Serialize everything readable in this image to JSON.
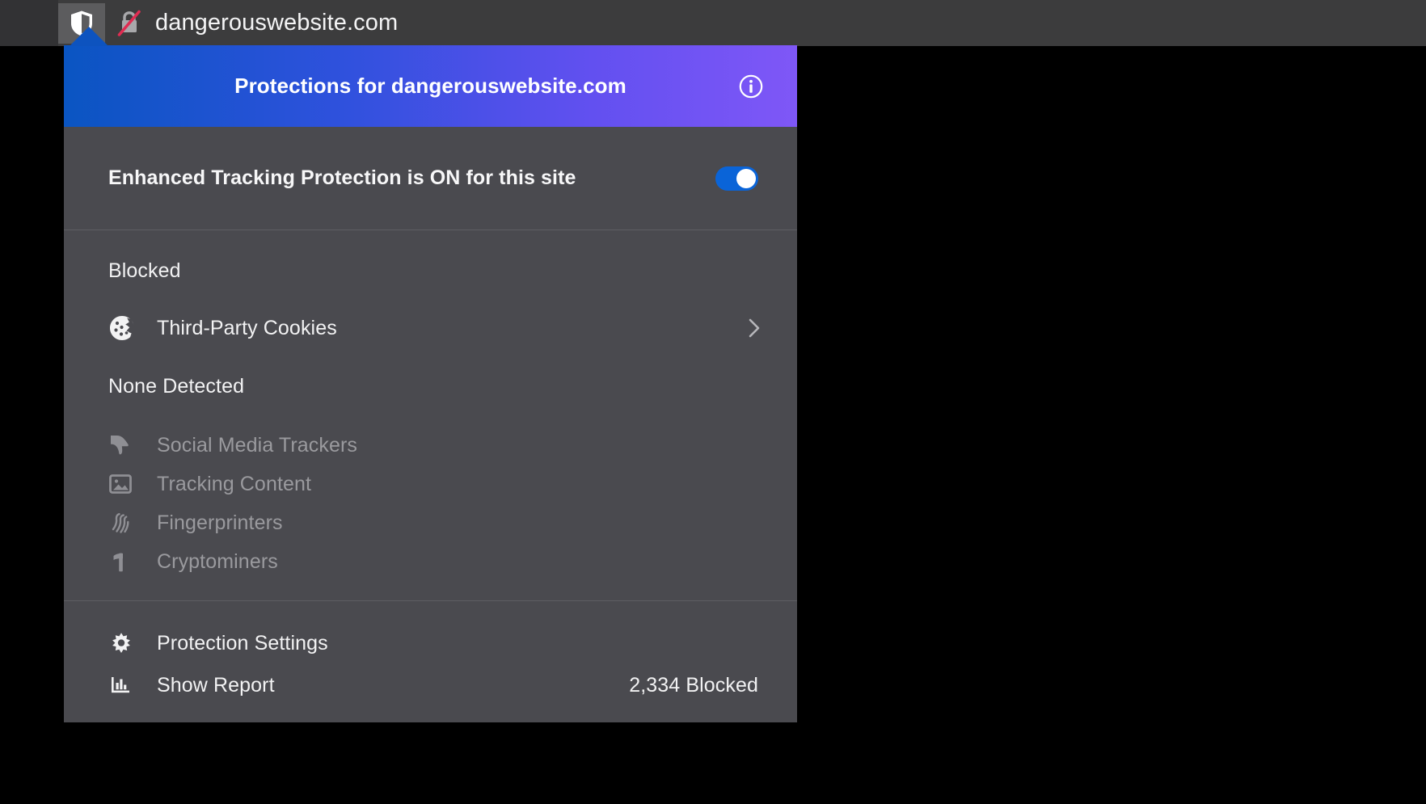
{
  "urlbar": {
    "url": "dangerouswebsite.com",
    "shield_icon": "shield-icon",
    "connection_icon": "lock-slashed-insecure-icon"
  },
  "panel": {
    "header": {
      "title": "Protections for dangerouswebsite.com",
      "info_icon": "info-circle-icon",
      "gradient_start": "#0a55c2",
      "gradient_end": "#7f57f7"
    },
    "etp": {
      "label": "Enhanced Tracking Protection is ON for this site",
      "toggle_state": "on",
      "toggle_color": "#0a64d8"
    },
    "blocked": {
      "heading": "Blocked",
      "items": [
        {
          "label": "Third-Party Cookies",
          "icon": "cookie-icon",
          "chevron": "chevron-right-icon"
        }
      ]
    },
    "none_detected": {
      "heading": "None Detected",
      "items": [
        {
          "label": "Social Media Trackers",
          "icon": "thumbs-down-icon"
        },
        {
          "label": "Tracking Content",
          "icon": "image-icon"
        },
        {
          "label": "Fingerprinters",
          "icon": "fingerprint-icon"
        },
        {
          "label": "Cryptominers",
          "icon": "pickaxe-icon"
        }
      ]
    },
    "footer": {
      "settings_label": "Protection Settings",
      "settings_icon": "gear-icon",
      "report_label": "Show Report",
      "report_icon": "bar-chart-icon",
      "blocked_count": "2,334 Blocked"
    }
  }
}
